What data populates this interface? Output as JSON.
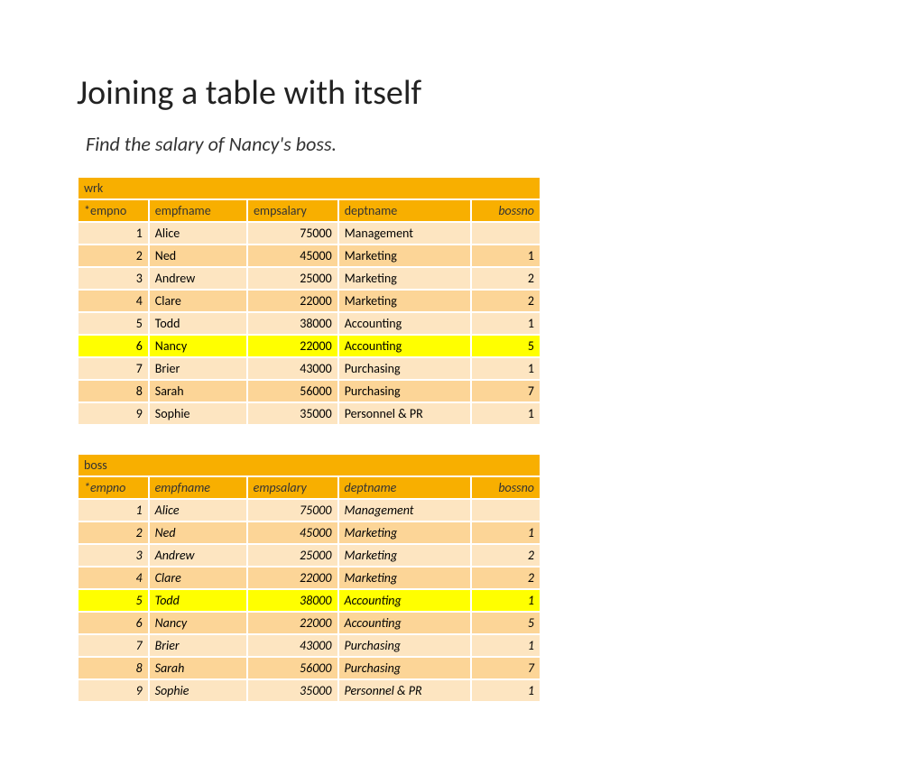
{
  "title": "Joining a table with itself",
  "subtitle": "Find the salary  of Nancy's boss.",
  "columns": {
    "empno": "*empno",
    "empfname": "empfname",
    "empsalary": "empsalary",
    "deptname": "deptname",
    "bossno": "bossno"
  },
  "table1": {
    "name": "wrk",
    "highlight_empno": 6,
    "rows": [
      {
        "empno": 1,
        "empfname": "Alice",
        "empsalary": 75000,
        "deptname": "Management",
        "bossno": ""
      },
      {
        "empno": 2,
        "empfname": "Ned",
        "empsalary": 45000,
        "deptname": "Marketing",
        "bossno": 1
      },
      {
        "empno": 3,
        "empfname": "Andrew",
        "empsalary": 25000,
        "deptname": "Marketing",
        "bossno": 2
      },
      {
        "empno": 4,
        "empfname": "Clare",
        "empsalary": 22000,
        "deptname": "Marketing",
        "bossno": 2
      },
      {
        "empno": 5,
        "empfname": "Todd",
        "empsalary": 38000,
        "deptname": "Accounting",
        "bossno": 1
      },
      {
        "empno": 6,
        "empfname": "Nancy",
        "empsalary": 22000,
        "deptname": "Accounting",
        "bossno": 5
      },
      {
        "empno": 7,
        "empfname": "Brier",
        "empsalary": 43000,
        "deptname": "Purchasing",
        "bossno": 1
      },
      {
        "empno": 8,
        "empfname": "Sarah",
        "empsalary": 56000,
        "deptname": "Purchasing",
        "bossno": 7
      },
      {
        "empno": 9,
        "empfname": "Sophie",
        "empsalary": 35000,
        "deptname": "Personnel & PR",
        "bossno": 1
      }
    ]
  },
  "table2": {
    "name": "boss",
    "highlight_empno": 5,
    "rows": [
      {
        "empno": 1,
        "empfname": "Alice",
        "empsalary": 75000,
        "deptname": "Management",
        "bossno": ""
      },
      {
        "empno": 2,
        "empfname": "Ned",
        "empsalary": 45000,
        "deptname": "Marketing",
        "bossno": 1
      },
      {
        "empno": 3,
        "empfname": "Andrew",
        "empsalary": 25000,
        "deptname": "Marketing",
        "bossno": 2
      },
      {
        "empno": 4,
        "empfname": "Clare",
        "empsalary": 22000,
        "deptname": "Marketing",
        "bossno": 2
      },
      {
        "empno": 5,
        "empfname": "Todd",
        "empsalary": 38000,
        "deptname": "Accounting",
        "bossno": 1
      },
      {
        "empno": 6,
        "empfname": "Nancy",
        "empsalary": 22000,
        "deptname": "Accounting",
        "bossno": 5
      },
      {
        "empno": 7,
        "empfname": "Brier",
        "empsalary": 43000,
        "deptname": "Purchasing",
        "bossno": 1
      },
      {
        "empno": 8,
        "empfname": "Sarah",
        "empsalary": 56000,
        "deptname": "Purchasing",
        "bossno": 7
      },
      {
        "empno": 9,
        "empfname": "Sophie",
        "empsalary": 35000,
        "deptname": "Personnel & PR",
        "bossno": 1
      }
    ]
  }
}
